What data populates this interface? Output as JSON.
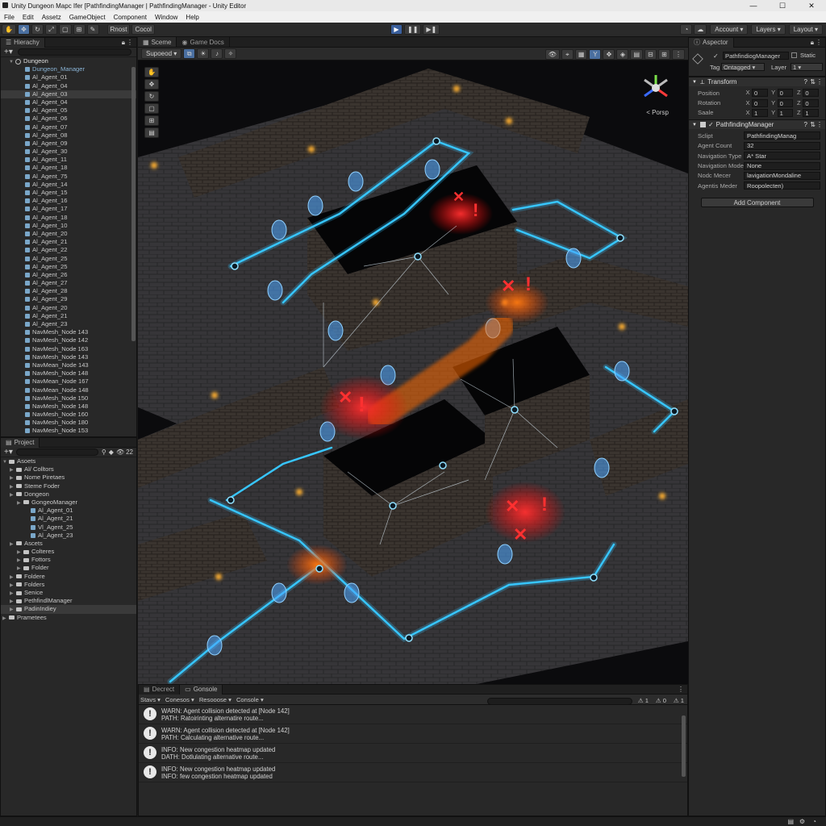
{
  "window": {
    "title": "Unity Dungeon Mapc Ifer [PathfindingManager | PathfindingManager - Unity Editor"
  },
  "menu": [
    "File",
    "Edit",
    "Assetz",
    "GameObject",
    "Component",
    "Window",
    "Help"
  ],
  "toolbar": {
    "pivot_label": "Rnost",
    "local_label": "Cocol",
    "account": "Account",
    "layers": "Layers",
    "layout": "Layout"
  },
  "hierarchy": {
    "tab": "Hierachy",
    "root": "Dungeon",
    "items": [
      "Dungeon_Manager",
      "Al_Agent_01",
      "Al_Agent_04",
      "Al_Agent_03",
      "Al_Agent_04",
      "Al_Agent_05",
      "Al_Agent_06",
      "Al_Agent_07",
      "Al_Agent_08",
      "Al_Agent_09",
      "Al_Agent_30",
      "Al_Agent_11",
      "Al_Agent_18",
      "Al_Agent_75",
      "Al_Agent_14",
      "Al_Agent_15",
      "Al_Agent_16",
      "Al_Agent_17",
      "Al_Agent_18",
      "Al_Agent_10",
      "Al_Agent_20",
      "Al_Agent_21",
      "Al_Agent_22",
      "Al_Agent_25",
      "Al_Agent_25",
      "Al_Agent_26",
      "Al_Agent_27",
      "Al_Agent_28",
      "Al_Agent_29",
      "Al_Agent_20",
      "Al_Agent_21",
      "Al_Agent_23",
      "NavMesh_Node 143",
      "NavMesh_Node 142",
      "NavMesh_Node 163",
      "NavMesh_Node 143",
      "NavMean_Node 143",
      "NavMesh_Node 148",
      "NavMean_Node 167",
      "NavMean_Node 148",
      "NavMesh_Node 150",
      "NavMesh_Node 148",
      "NavMesh_Node 160",
      "NavMesh_Node 180",
      "NavMesh_Node 153"
    ]
  },
  "project": {
    "tab": "Project",
    "count": "22",
    "root": "Asoets",
    "items": [
      {
        "label": "Al/ Colltors",
        "depth": 1,
        "kind": "folder"
      },
      {
        "label": "Nome Piretaes",
        "depth": 1,
        "kind": "folder"
      },
      {
        "label": "Steme Foder",
        "depth": 1,
        "kind": "folder"
      },
      {
        "label": "Dongeon",
        "depth": 1,
        "kind": "folder"
      },
      {
        "label": "GongeoManager",
        "depth": 2,
        "kind": "folder"
      },
      {
        "label": "Al_Agent_01",
        "depth": 3,
        "kind": "cube"
      },
      {
        "label": "Al_Agent_21",
        "depth": 3,
        "kind": "cube"
      },
      {
        "label": "Vl_Agent_25",
        "depth": 3,
        "kind": "cube"
      },
      {
        "label": "Al_Agent_23",
        "depth": 3,
        "kind": "cube"
      },
      {
        "label": "Ascets",
        "depth": 1,
        "kind": "folder"
      },
      {
        "label": "Colteres",
        "depth": 2,
        "kind": "folder"
      },
      {
        "label": "Fottors",
        "depth": 2,
        "kind": "folder"
      },
      {
        "label": "Folder",
        "depth": 2,
        "kind": "folder"
      },
      {
        "label": "Foldere",
        "depth": 1,
        "kind": "folder"
      },
      {
        "label": "Folders",
        "depth": 1,
        "kind": "folder"
      },
      {
        "label": "Senice",
        "depth": 1,
        "kind": "folder"
      },
      {
        "label": "PethfindlManager",
        "depth": 1,
        "kind": "folder"
      },
      {
        "label": "PadinIndiey",
        "depth": 1,
        "kind": "folder"
      },
      {
        "label": "Prametees",
        "depth": 0,
        "kind": "folder"
      }
    ]
  },
  "scene": {
    "tab_scene": "Sceme",
    "tab_game": "Game Docs",
    "shading": "Supoeod",
    "persp": "< Porsp"
  },
  "inspector": {
    "tab": "Aspector",
    "object_name": "PathfindiogManager",
    "static_label": "Static",
    "tag_label": "Tag",
    "tag_value": "Ontagged",
    "layer_label": "Layer",
    "layer_value": "1",
    "transform": {
      "title": "Transform",
      "rows": [
        {
          "label": "Position",
          "x": "0",
          "y": "0",
          "z": "0"
        },
        {
          "label": "Rotation",
          "x": "0",
          "y": "0",
          "z": "0"
        },
        {
          "label": "Saale",
          "x": "1",
          "y": "1",
          "z": "1"
        }
      ]
    },
    "component": {
      "title": "PathfindingManager",
      "rows": [
        {
          "label": "Sclipt",
          "value": "PathfindingManag"
        },
        {
          "label": "Agent Count",
          "value": "32"
        },
        {
          "label": "Navigation Type",
          "value": "A* Star"
        },
        {
          "label": "Navigation Mode",
          "value": "None"
        },
        {
          "label": "Nodc Mecer",
          "value": "lavigationMondaline"
        },
        {
          "label": "Agentis Meder",
          "value": "Roopolecten)"
        }
      ]
    },
    "add_component": "Add Component"
  },
  "console": {
    "tab_project": "Decrect",
    "tab_console": "Gonsole",
    "filters": [
      "Stavs",
      "Conesos",
      "Resooose",
      "Console"
    ],
    "counts": [
      "1",
      "0",
      "1"
    ],
    "logs": [
      {
        "line1": "WARN: Agent collision detected at [Node 142]",
        "line2": "PATH: Ratoirinting alternatire route..."
      },
      {
        "line1": "WARN: Agent collision detected at [Node 142]",
        "line2": "PATH: Calculating alternative route..."
      },
      {
        "line1": "INFO: New congestion heatmap updated",
        "line2": "DATH: Dotlulating alternative route..."
      },
      {
        "line1": "INFO: New congestion heatmap updated",
        "line2": "INFO: few congestion heatmap updated"
      }
    ]
  },
  "colors": {
    "path": "#37c6ff",
    "warning": "#ff2a2a",
    "heat": "#ff6a00",
    "panel": "#282828"
  }
}
